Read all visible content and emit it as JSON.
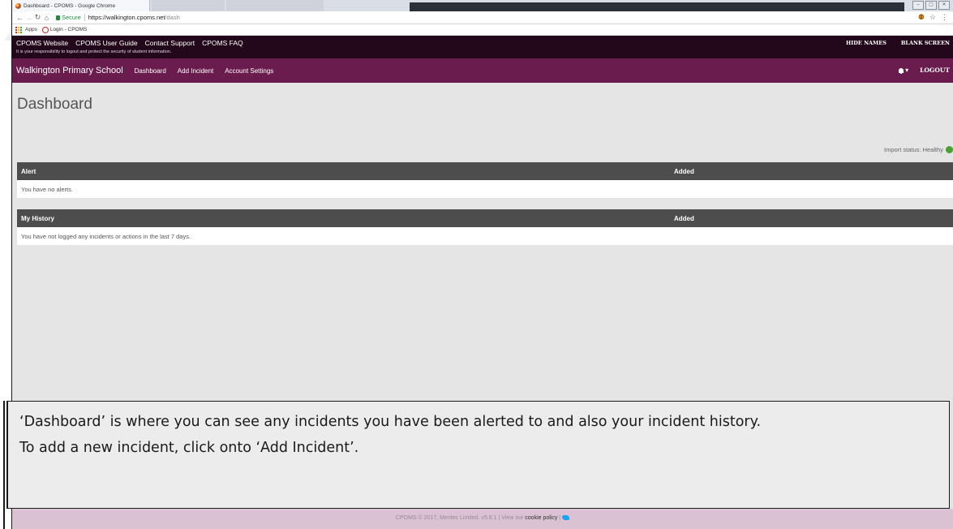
{
  "browser": {
    "tab_title": "Dashboard - CPOMS - Google Chrome",
    "secure_label": "Secure",
    "url_host": "https://walkington.cpoms.net",
    "url_path": "/dash",
    "bookmarks": {
      "apps_label": "Apps",
      "login_label": "Login - CPOMS"
    }
  },
  "topbar": {
    "links": [
      "CPOMS Website",
      "CPOMS User Guide",
      "Contact Support",
      "CPOMS FAQ"
    ],
    "note": "It is your responsibility to logout and protect the security of student information.",
    "hide_names": "HIDE NAMES",
    "blank_screen": "BLANK SCREEN"
  },
  "navbar": {
    "brand": "Walkington Primary School",
    "links": [
      "Dashboard",
      "Add Incident",
      "Account Settings"
    ],
    "logout": "LOGOUT"
  },
  "main": {
    "title": "Dashboard",
    "import_status": "Import status: Healthy",
    "alerts_table": {
      "col1": "Alert",
      "col2": "Added",
      "empty": "You have no alerts."
    },
    "history_table": {
      "col1": "My History",
      "col2": "Added",
      "empty": "You have not logged any incidents or actions in the last 7 days."
    }
  },
  "overlay": {
    "line1": "‘Dashboard’ is where you can see any incidents you have been alerted to and also your incident history.",
    "line2": "To add a new incident, click onto ‘Add Incident’."
  },
  "footer": {
    "text": "CPOMS © 2017, Meritec Limited. v5.8.1 | View our ",
    "cookie": "cookie policy",
    "sep": " | "
  },
  "colors": {
    "topbar": "#22081a",
    "navbar": "#6a1c4e",
    "table_header": "#4d4d4d",
    "footer": "#dac2d2",
    "status_healthy": "#4aa030"
  }
}
